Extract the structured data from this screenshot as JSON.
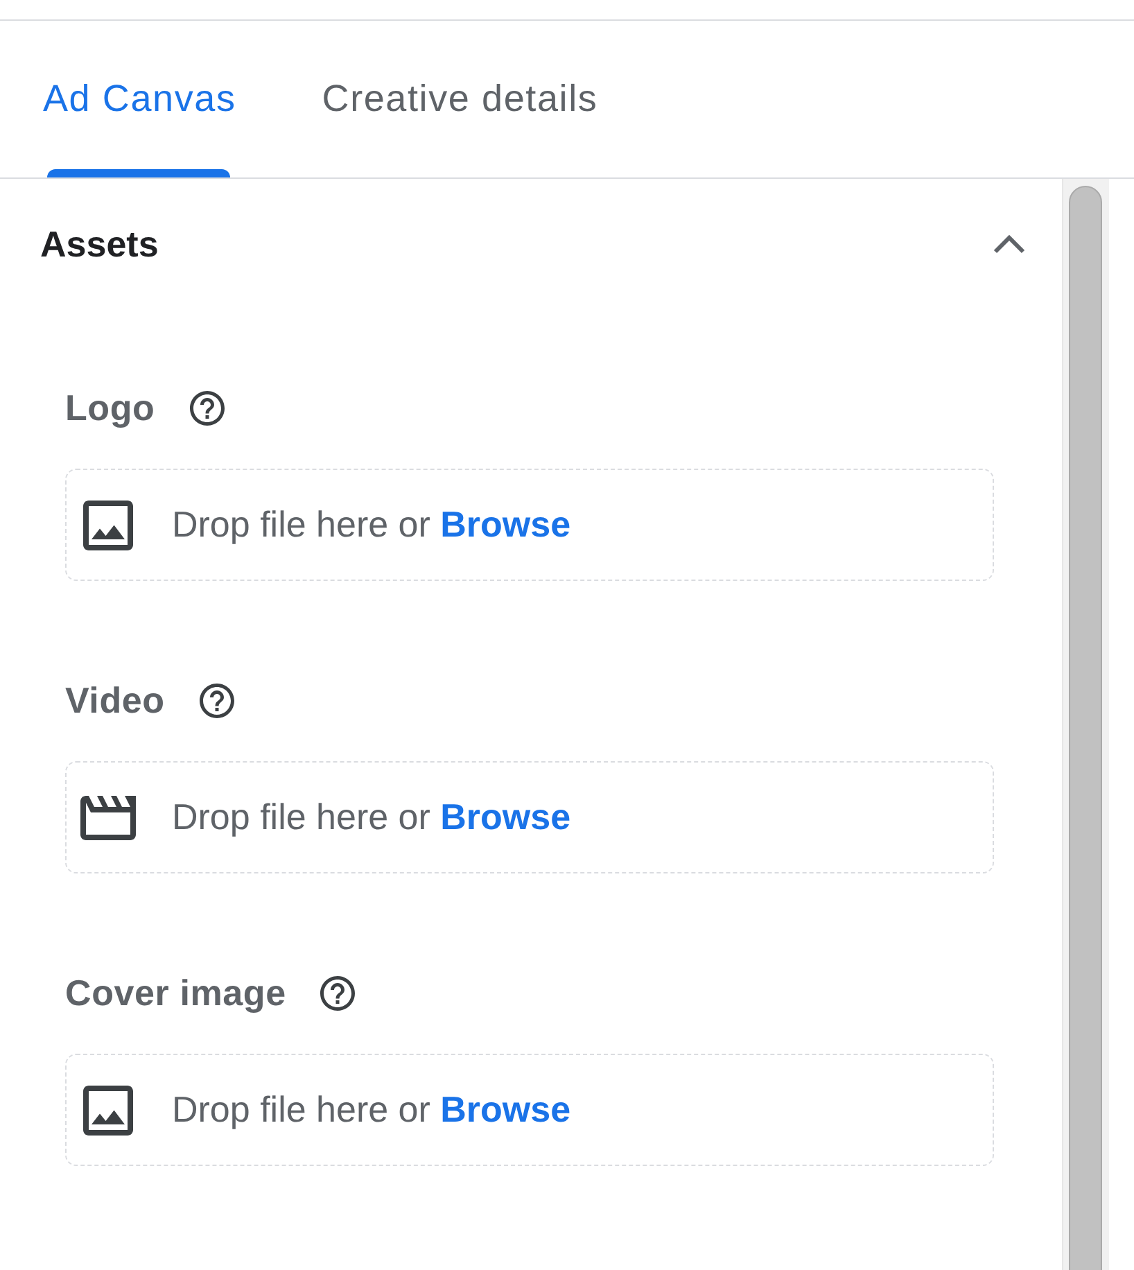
{
  "tabs": [
    {
      "label": "Ad Canvas",
      "selected": true
    },
    {
      "label": "Creative details",
      "selected": false
    }
  ],
  "section": {
    "title": "Assets",
    "expanded": true,
    "fields": [
      {
        "label": "Logo",
        "kind": "image",
        "hint": "Drop file here or",
        "link": "Browse"
      },
      {
        "label": "Video",
        "kind": "video",
        "hint": "Drop file here or",
        "link": "Browse"
      },
      {
        "label": "Cover image",
        "kind": "image",
        "hint": "Drop file here or",
        "link": "Browse"
      }
    ]
  }
}
